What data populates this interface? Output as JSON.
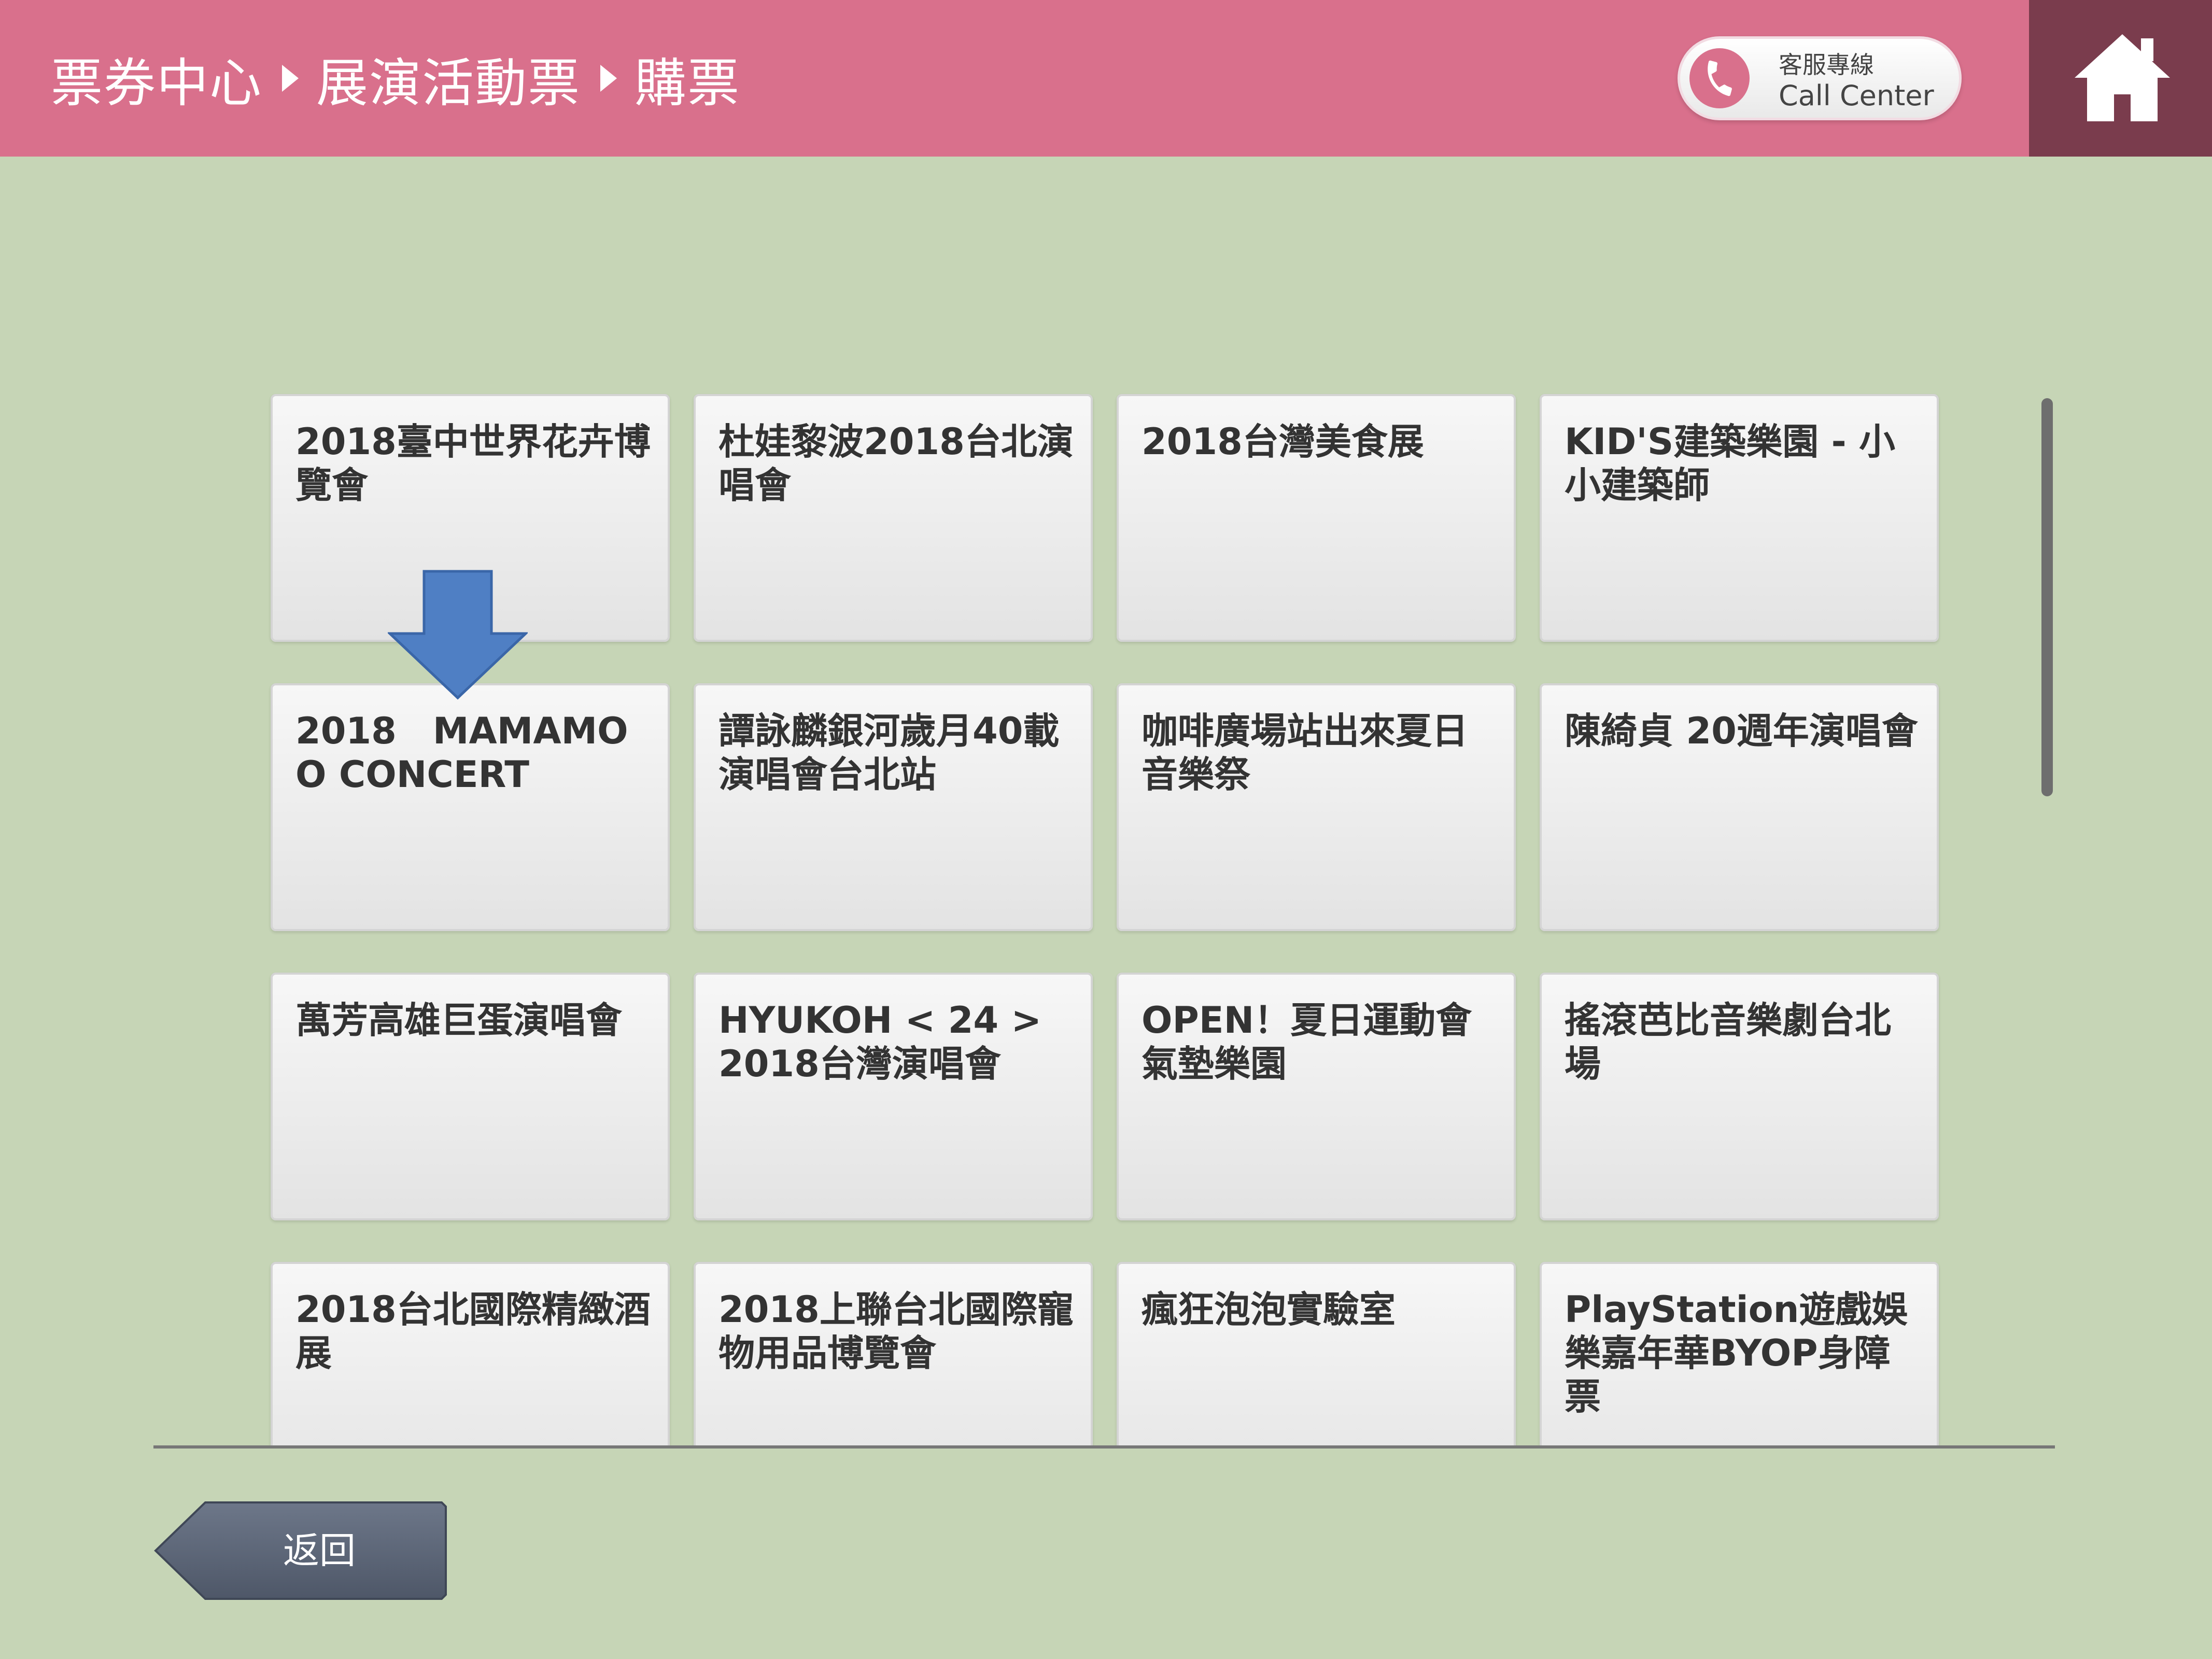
{
  "header": {
    "breadcrumb": [
      "票券中心",
      "展演活動票",
      "購票"
    ],
    "call_center": {
      "label_zh": "客服專線",
      "label_en": "Call Center"
    },
    "home_icon": "home-icon"
  },
  "events": [
    {
      "label": "2018臺中世界花卉博覽會"
    },
    {
      "label": "杜娃黎波2018台北演唱會"
    },
    {
      "label": "2018台灣美食展"
    },
    {
      "label": "KID'S建築樂園 - 小小建築師"
    },
    {
      "label": "2018　MAMAMOO CONCERT"
    },
    {
      "label": "譚詠麟銀河歲月40載演唱會台北站"
    },
    {
      "label": "咖啡廣場站出來夏日音樂祭"
    },
    {
      "label": "陳綺貞 20週年演唱會"
    },
    {
      "label": "萬芳高雄巨蛋演唱會"
    },
    {
      "label": "HYUKOH < 24 > 2018台灣演唱會"
    },
    {
      "label": "OPEN！夏日運動會氣墊樂園"
    },
    {
      "label": "搖滾芭比音樂劇台北場"
    },
    {
      "label": "2018台北國際精緻酒展"
    },
    {
      "label": "2018上聯台北國際寵物用品博覽會"
    },
    {
      "label": "瘋狂泡泡實驗室"
    },
    {
      "label": "PlayStation遊戲娛樂嘉年華BYOP身障票"
    }
  ],
  "footer": {
    "back_label": "返回"
  },
  "colors": {
    "header": "#d9708c",
    "home_box": "#7a3c4d",
    "background": "#c6d5b6",
    "arrow": "#4f7fc4",
    "back_button": "#5b6577"
  }
}
